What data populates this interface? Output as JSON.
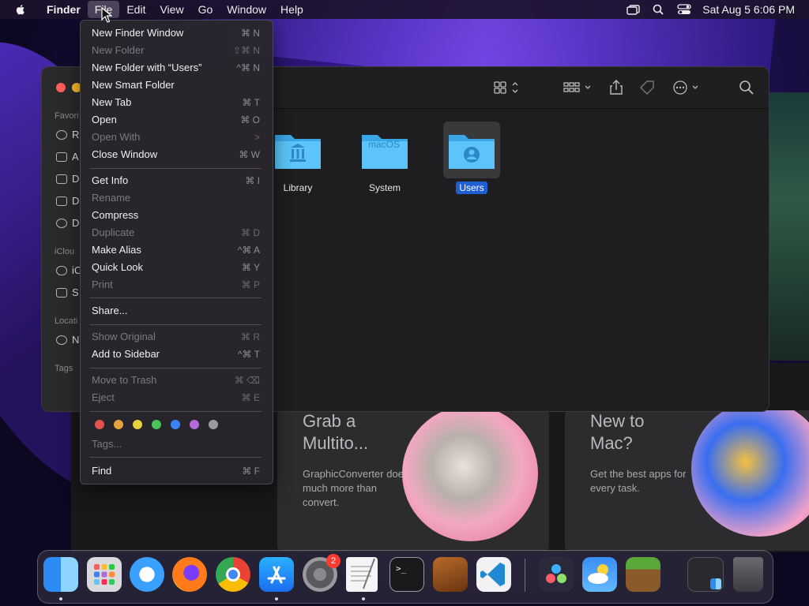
{
  "menubar": {
    "app": "Finder",
    "items": [
      "File",
      "Edit",
      "View",
      "Go",
      "Window",
      "Help"
    ],
    "clock": "Sat Aug 5  6:06 PM"
  },
  "file_menu": {
    "items": [
      {
        "label": "New Finder Window",
        "shortcut": "⌘ N",
        "disabled": false
      },
      {
        "label": "New Folder",
        "shortcut": "⇧⌘ N",
        "disabled": true
      },
      {
        "label": "New Folder with “Users”",
        "shortcut": "^⌘ N",
        "disabled": false
      },
      {
        "label": "New Smart Folder",
        "shortcut": "",
        "disabled": false
      },
      {
        "label": "New Tab",
        "shortcut": "⌘ T",
        "disabled": false
      },
      {
        "label": "Open",
        "shortcut": "⌘ O",
        "disabled": false
      },
      {
        "label": "Open With",
        "shortcut": ">",
        "disabled": true
      },
      {
        "label": "Close Window",
        "shortcut": "⌘ W",
        "disabled": false
      },
      {
        "label": "Get Info",
        "shortcut": "⌘ I",
        "disabled": false
      },
      {
        "label": "Rename",
        "shortcut": "",
        "disabled": true
      },
      {
        "label": "Compress",
        "shortcut": "",
        "disabled": false
      },
      {
        "label": "Duplicate",
        "shortcut": "⌘ D",
        "disabled": true
      },
      {
        "label": "Make Alias",
        "shortcut": "^⌘ A",
        "disabled": false
      },
      {
        "label": "Quick Look",
        "shortcut": "⌘ Y",
        "disabled": false
      },
      {
        "label": "Print",
        "shortcut": "⌘ P",
        "disabled": true
      },
      {
        "label": "Share...",
        "shortcut": "",
        "disabled": false
      },
      {
        "label": "Show Original",
        "shortcut": "⌘ R",
        "disabled": true
      },
      {
        "label": "Add to Sidebar",
        "shortcut": "^⌘ T",
        "disabled": false
      },
      {
        "label": "Move to Trash",
        "shortcut": "⌘ ⌫",
        "disabled": true
      },
      {
        "label": "Eject",
        "shortcut": "⌘ E",
        "disabled": true
      },
      {
        "label": "Tags...",
        "shortcut": "",
        "disabled": true
      },
      {
        "label": "Find",
        "shortcut": "⌘ F",
        "disabled": false
      }
    ],
    "tag_colors": [
      "#e0524a",
      "#e6a23c",
      "#e6d23c",
      "#4cc25a",
      "#3a82f6",
      "#b46ad8",
      "#9a9a9e"
    ]
  },
  "finder": {
    "sidebar": {
      "favorites_label": "Favori",
      "icloud_label": "iClou",
      "locations_label": "Locati",
      "tags_label": "Tags",
      "fav_items": [
        "R",
        "A",
        "D",
        "D",
        "D"
      ],
      "icloud_items": [
        "iC",
        "S"
      ],
      "location_items": [
        "N"
      ]
    },
    "folders": [
      {
        "label": "Library",
        "glyph": "library-icon",
        "selected": false
      },
      {
        "label": "System",
        "glyph": "macOS",
        "selected": false
      },
      {
        "label": "Users",
        "glyph": "user-icon",
        "selected": true
      }
    ]
  },
  "store": {
    "cards": [
      {
        "title": "Grab a Multito...",
        "line1": "Grab a",
        "line2": "Multito...",
        "desc": "GraphicConverter does much more than convert."
      },
      {
        "title": "New to Mac?",
        "line1": "New to",
        "line2": "Mac?",
        "desc": "Get the best apps for every task."
      }
    ]
  },
  "dock": {
    "apps": [
      "Finder",
      "Launchpad",
      "Safari",
      "Firefox",
      "Chrome",
      "App Store",
      "System Settings",
      "TextEdit",
      "Terminal",
      "GarageBand",
      "Visual Studio Code",
      "DaVinci Resolve",
      "Weather",
      "Minecraft",
      "Finder Window",
      "Trash"
    ],
    "settings_badge": "2"
  }
}
